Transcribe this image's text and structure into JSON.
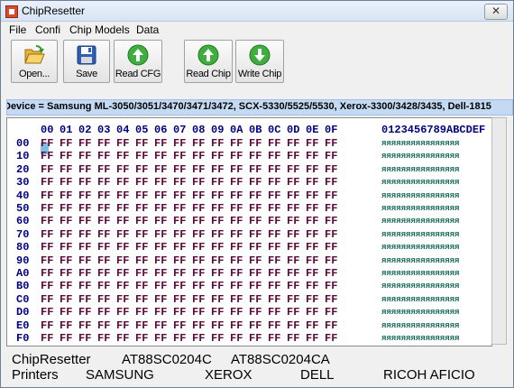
{
  "window": {
    "title": "ChipResetter",
    "close_label": "✕"
  },
  "menu": [
    "File",
    "Confi",
    "Chip Models",
    "Data"
  ],
  "toolbar": {
    "open": "Open...",
    "save": "Save",
    "read_cfg": "Read CFG",
    "read_chip": "Read Chip",
    "write_chip": "Write Chip"
  },
  "device": "Device =  Samsung ML-3050/3051/3470/3471/3472, SCX-5330/5525/5530, Xerox-3300/3428/3435, Dell-1815",
  "hex": {
    "columns": [
      "00",
      "01",
      "02",
      "03",
      "04",
      "05",
      "06",
      "07",
      "08",
      "09",
      "0A",
      "0B",
      "0C",
      "0D",
      "0E",
      "0F"
    ],
    "ascii_header": "0123456789ABCDEF",
    "rows": [
      "00",
      "10",
      "20",
      "30",
      "40",
      "50",
      "60",
      "70",
      "80",
      "90",
      "A0",
      "B0",
      "C0",
      "D0",
      "E0",
      "F0"
    ],
    "cell_value": "FF",
    "ascii_row": "яяяяяяяяяяяяяяяя"
  },
  "footer": {
    "line1": [
      "ChipResetter",
      "AT88SC0204C",
      "AT88SC0204CA"
    ],
    "line2": [
      "Printers",
      "SAMSUNG",
      "XEROX",
      "DELL",
      "RICOH AFICIO"
    ]
  },
  "colors": {
    "titlebar": "#dae6f5",
    "device_bar": "#c4daf2",
    "hex_address": "#000080",
    "hex_cell": "#5b0a3a",
    "ascii_text": "#1a6b5a"
  },
  "icons": {
    "open": "folder-open-icon",
    "save": "floppy-disk-icon",
    "read_cfg": "green-up-arrow-icon",
    "read_chip": "green-up-arrow-icon",
    "write_chip": "green-down-arrow-icon"
  }
}
